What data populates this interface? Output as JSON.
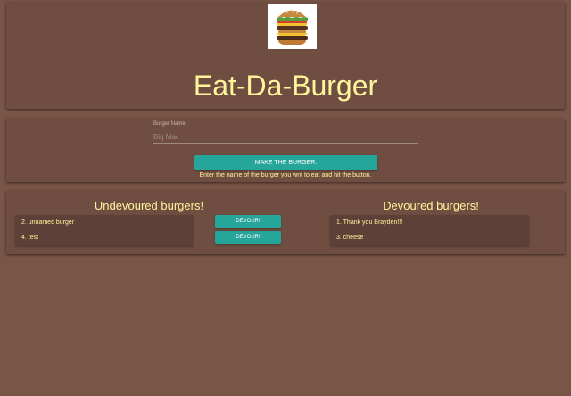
{
  "header": {
    "title": "Eat-Da-Burger",
    "logo": "burger-image"
  },
  "form": {
    "label": "Burger Name",
    "placeholder": "Big Mac",
    "value": "",
    "submit_label": "Make the burger.",
    "hint": "Enter the name of the burger you wnt to eat and hit the button."
  },
  "undevoured": {
    "title": "Undevoured burgers!",
    "items": [
      {
        "label": "2. unnamed burger",
        "button": "Devour!"
      },
      {
        "label": "4. test",
        "button": "Devour!"
      }
    ]
  },
  "devoured": {
    "title": "Devoured burgers!",
    "items": [
      {
        "label": "1. Thank you Brayden!!!"
      },
      {
        "label": "3. cheese"
      }
    ]
  },
  "colors": {
    "background": "#795548",
    "card": "#6f4e41",
    "list_panel": "#5d4037",
    "accent": "#26a69a",
    "text": "#fff59d"
  }
}
